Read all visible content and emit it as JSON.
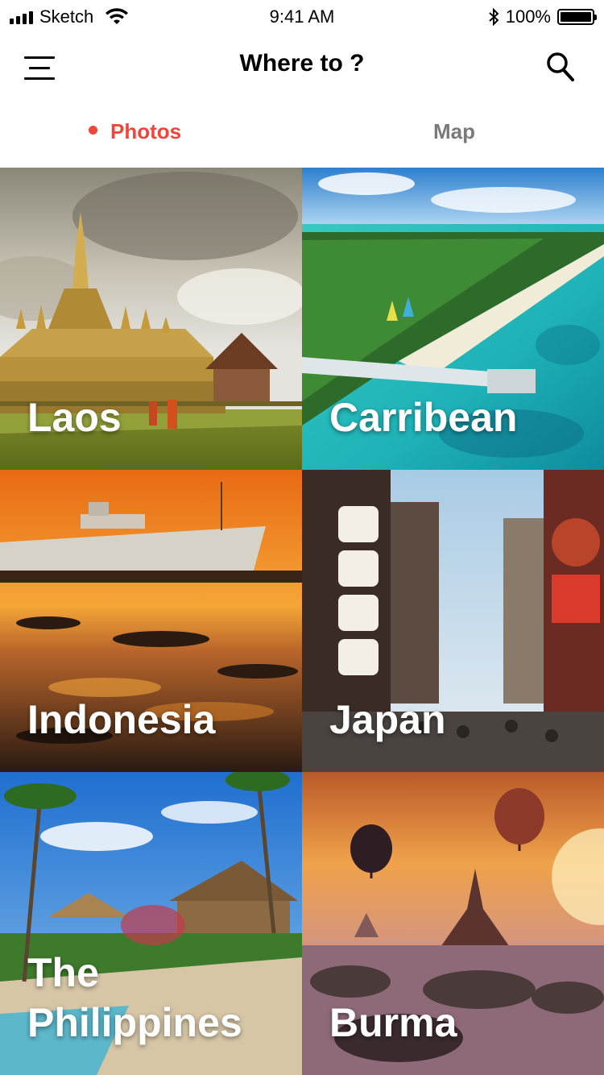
{
  "status_bar": {
    "carrier": "Sketch",
    "time": "9:41 AM",
    "battery": "100%"
  },
  "nav": {
    "title": "Where to ?"
  },
  "tabs": [
    {
      "label": "Photos",
      "active": true
    },
    {
      "label": "Map",
      "active": false
    }
  ],
  "accent_color": "#f0453a",
  "destinations": [
    {
      "name": "Laos"
    },
    {
      "name": "Carribean"
    },
    {
      "name": "Indonesia"
    },
    {
      "name": "Japan"
    },
    {
      "name": "The Philippines"
    },
    {
      "name": "Burma"
    }
  ]
}
